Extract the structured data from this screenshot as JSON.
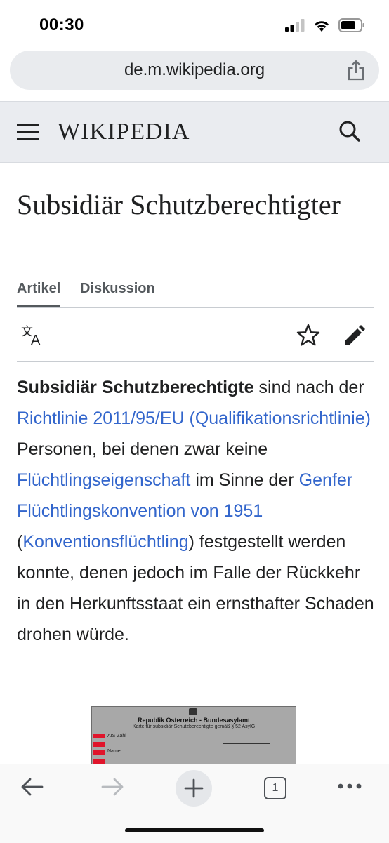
{
  "status": {
    "time": "00:30"
  },
  "browser": {
    "url": "de.m.wikipedia.org",
    "tab_count": "1"
  },
  "header": {
    "logo": "WIKIPEDIA"
  },
  "article": {
    "title": "Subsidiär Schutzberechtigter",
    "tabs": [
      {
        "label": "Artikel",
        "active": true
      },
      {
        "label": "Diskussion",
        "active": false
      }
    ],
    "paragraph": [
      {
        "type": "bold",
        "text": "Subsidiär Schutzberechtigte"
      },
      {
        "type": "text",
        "text": " sind nach der "
      },
      {
        "type": "link",
        "text": "Richtlinie 2011/95/EU (Qualifikationsrichtlinie)"
      },
      {
        "type": "text",
        "text": " Personen, bei denen zwar keine "
      },
      {
        "type": "link",
        "text": "Flüchtlingseigenschaft"
      },
      {
        "type": "text",
        "text": " im Sinne der "
      },
      {
        "type": "link",
        "text": "Genfer Flüchtlingskonvention von 1951"
      },
      {
        "type": "text",
        "text": " ("
      },
      {
        "type": "link",
        "text": "Konventionsflüchtling"
      },
      {
        "type": "text",
        "text": ") festgestellt werden konnte, denen jedoch im Falle der Rückkehr in den Herkunftsstaat ein ernsthafter Schaden drohen würde."
      }
    ],
    "figure": {
      "heading": "Republik Österreich - Bundesasylamt",
      "subheading": "Karte für subsidiär Schutzberechtigte gemäß § 52 AsylG",
      "field_labels": [
        "AIS Zahl",
        "Name"
      ]
    }
  },
  "colors": {
    "link": "#3366cc",
    "header_bg": "#eaecf0",
    "text": "#202122"
  },
  "icons": [
    "signal-icon",
    "wifi-icon",
    "battery-icon",
    "share-icon",
    "menu-icon",
    "search-icon",
    "language-icon",
    "star-icon",
    "edit-icon",
    "back-icon",
    "forward-icon",
    "new-tab-icon",
    "tabs-icon",
    "more-icon"
  ]
}
